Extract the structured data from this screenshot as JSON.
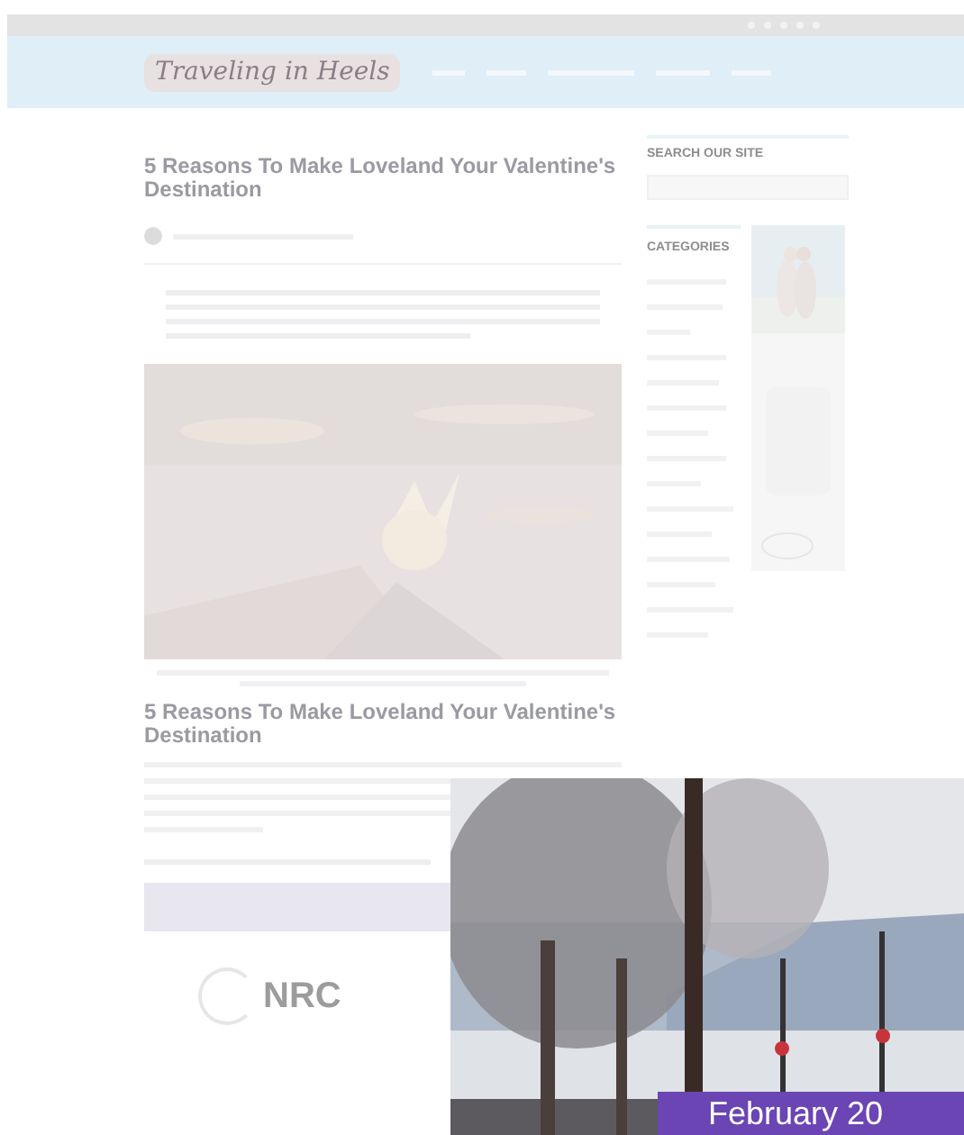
{
  "header": {
    "logo": "Traveling in Heels"
  },
  "article": {
    "title": "5 Reasons To Make Loveland Your Valentine's Destination",
    "heading": "5 Reasons To Make Loveland Your Valentine's Destination"
  },
  "sidebar": {
    "search_title": "SEARCH OUR SITE",
    "categories_title": "CATEGORIES"
  },
  "footer_logo": "NRC",
  "video_popup": {
    "caption": "February 20"
  }
}
